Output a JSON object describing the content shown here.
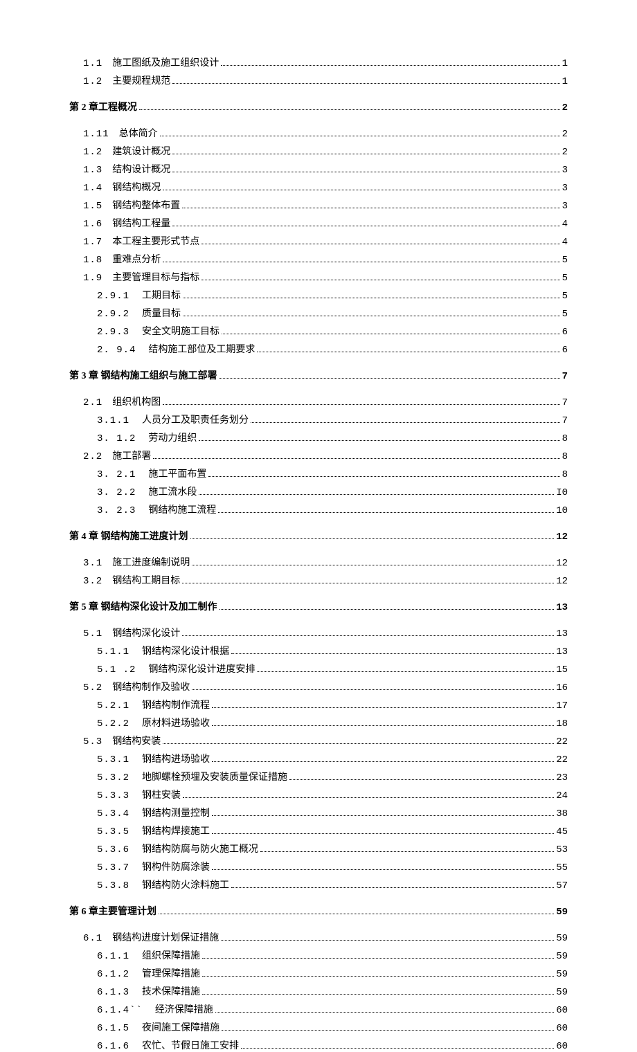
{
  "toc": [
    {
      "level": 1,
      "num": "1.1",
      "title": "施工图纸及施工组织设计",
      "page": "1"
    },
    {
      "level": 1,
      "num": "1.2",
      "title": "主要规程规范",
      "page": "1"
    },
    {
      "level": 0,
      "num": "",
      "title": "第 2 章工程概况",
      "page": "2"
    },
    {
      "level": 1,
      "num": "1.11",
      "title": "总体简介",
      "page": "2"
    },
    {
      "level": 1,
      "num": "1.2",
      "title": "建筑设计概况",
      "page": "2"
    },
    {
      "level": 1,
      "num": "1.3",
      "title": "结构设计概况",
      "page": "3"
    },
    {
      "level": 1,
      "num": "1.4",
      "title": "钢结构概况",
      "page": "3"
    },
    {
      "level": 1,
      "num": "1.5",
      "title": "钢结构整体布置",
      "page": "3"
    },
    {
      "level": 1,
      "num": "1.6",
      "title": "钢结构工程量",
      "page": "4"
    },
    {
      "level": 1,
      "num": "1.7",
      "title": "本工程主要形式节点",
      "page": "4"
    },
    {
      "level": 1,
      "num": "1.8",
      "title": "重难点分析",
      "page": "5"
    },
    {
      "level": 1,
      "num": "1.9",
      "title": "主要管理目标与指标",
      "page": "5"
    },
    {
      "level": 2,
      "num": "2.9.1",
      "title": "工期目标",
      "page": "5"
    },
    {
      "level": 2,
      "num": "2.9.2",
      "title": "质量目标",
      "page": "5"
    },
    {
      "level": 2,
      "num": "2.9.3",
      "title": "安全文明施工目标",
      "page": "6"
    },
    {
      "level": 2,
      "num": "2.  9.4",
      "title": "结构施工部位及工期要求",
      "page": "6"
    },
    {
      "level": 0,
      "num": "",
      "title": "第 3 章   钢结构施工组织与施工部署",
      "page": "7"
    },
    {
      "level": 1,
      "num": "2.1",
      "title": "组织机构图",
      "page": "7"
    },
    {
      "level": 2,
      "num": "3.1.1",
      "title": "人员分工及职责任务划分",
      "page": "7"
    },
    {
      "level": 2,
      "num": "3.   1.2",
      "title": "劳动力组织",
      "page": "8"
    },
    {
      "level": 1,
      "num": "2.2",
      "title": "施工部署",
      "page": "8"
    },
    {
      "level": 2,
      "num": "3.  2.1",
      "title": "施工平面布置",
      "page": "8"
    },
    {
      "level": 2,
      "num": "3.  2.2",
      "title": "施工流水段",
      "page": "I0"
    },
    {
      "level": 2,
      "num": "3.  2.3",
      "title": "钢结构施工流程",
      "page": "10"
    },
    {
      "level": 0,
      "num": "",
      "title": "第 4 章   钢结构施工进度计划",
      "page": "12"
    },
    {
      "level": 1,
      "num": "3.1",
      "title": "施工进度编制说明",
      "page": "12"
    },
    {
      "level": 1,
      "num": "3.2",
      "title": "钢结构工期目标",
      "page": "12"
    },
    {
      "level": 0,
      "num": "",
      "title": "第 5 章   钢结构深化设计及加工制作",
      "page": "13"
    },
    {
      "level": 1,
      "num": "5.1",
      "title": "钢结构深化设计",
      "page": "13"
    },
    {
      "level": 2,
      "num": "5.1.1",
      "title": "钢结构深化设计根据",
      "page": "13"
    },
    {
      "level": 2,
      "num": "5.1  .2",
      "title": "钢结构深化设计进度安排",
      "page": "15"
    },
    {
      "level": 1,
      "num": "5.2",
      "title": "钢结构制作及验收",
      "page": "16"
    },
    {
      "level": 2,
      "num": "5.2.1",
      "title": "钢结构制作流程",
      "page": "17"
    },
    {
      "level": 2,
      "num": "5.2.2",
      "title": "原材料进场验收",
      "page": "18"
    },
    {
      "level": 1,
      "num": "5.3",
      "title": "钢结构安装",
      "page": "22"
    },
    {
      "level": 2,
      "num": "5.3.1",
      "title": "钢结构进场验收",
      "page": "22"
    },
    {
      "level": 2,
      "num": "5.3.2",
      "title": "地脚螺栓预埋及安装质量保证措施",
      "page": "23"
    },
    {
      "level": 2,
      "num": "5.3.3",
      "title": "钢柱安装",
      "page": "24"
    },
    {
      "level": 2,
      "num": "5.3.4",
      "title": "钢结构测量控制",
      "page": "38"
    },
    {
      "level": 2,
      "num": "5.3.5",
      "title": "钢结构焊接施工",
      "page": "45"
    },
    {
      "level": 2,
      "num": "5.3.6",
      "title": "钢结构防腐与防火施工概况",
      "page": "53"
    },
    {
      "level": 2,
      "num": "5.3.7",
      "title": "钢构件防腐涂装",
      "page": "55"
    },
    {
      "level": 2,
      "num": "5.3.8",
      "title": "钢结构防火涂料施工",
      "page": "57"
    },
    {
      "level": 0,
      "num": "",
      "title": "第 6 章主要管理计划",
      "page": "59"
    },
    {
      "level": 1,
      "num": "6.1",
      "title": "钢结构进度计划保证措施",
      "page": "59"
    },
    {
      "level": 2,
      "num": "6.1.1",
      "title": "组织保障措施",
      "page": "59"
    },
    {
      "level": 2,
      "num": "6.1.2",
      "title": "管理保障措施",
      "page": "59"
    },
    {
      "level": 2,
      "num": "6.1.3",
      "title": "技术保障措施",
      "page": "59"
    },
    {
      "level": 2,
      "num": "6.1.4``",
      "title": "经济保障措施",
      "page": "60"
    },
    {
      "level": 2,
      "num": "6.1.5",
      "title": "夜间施工保障措施",
      "page": "60"
    },
    {
      "level": 2,
      "num": "6.1.6",
      "title": "农忙、节假日施工安排",
      "page": "60"
    }
  ]
}
